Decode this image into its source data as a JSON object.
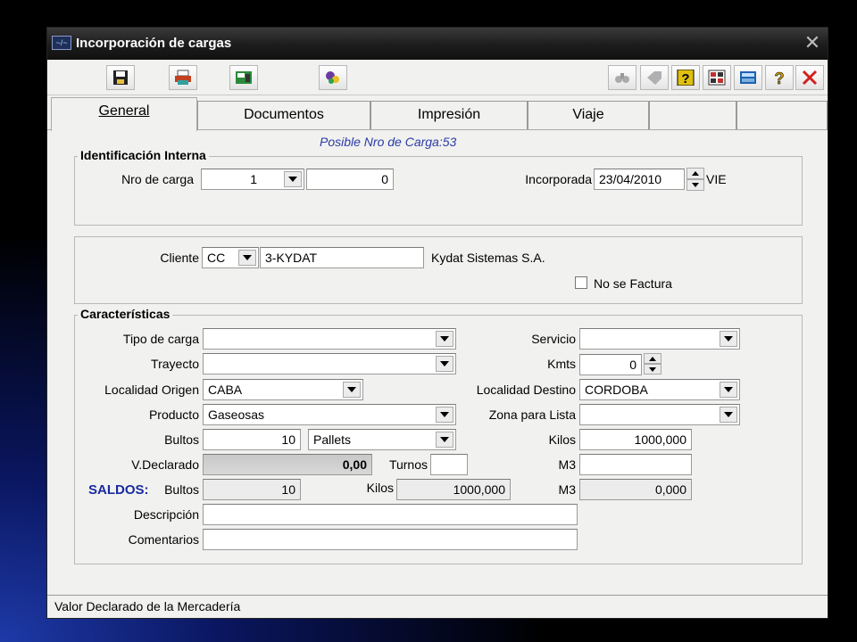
{
  "window": {
    "title": "Incorporación de cargas",
    "app_icon_glyph": "~/~"
  },
  "toolbar": {
    "left_icons": [
      "save-icon",
      "print-icon",
      "card-icon",
      "tools-icon"
    ],
    "right_icons": [
      "binoculars-icon",
      "tag-icon",
      "help-box-icon",
      "grid-icon",
      "calculator-icon",
      "question-icon",
      "close-x-icon"
    ]
  },
  "tabs": [
    {
      "label": "General",
      "active": true
    },
    {
      "label": "Documentos",
      "active": false
    },
    {
      "label": "Impresión",
      "active": false
    },
    {
      "label": "Viaje",
      "active": false
    },
    {
      "label": "",
      "active": false
    },
    {
      "label": "",
      "active": false
    }
  ],
  "possible_number": "Posible Nro de Carga:53",
  "identificacion": {
    "title": "Identificación Interna",
    "nro_label": "Nro de carga",
    "nro_value": "1",
    "nro_value2": "0",
    "incorporada_label": "Incorporada",
    "incorporada_value": "23/04/2010",
    "day": "VIE"
  },
  "cliente": {
    "label": "Cliente",
    "type": "CC",
    "code": "3-KYDAT",
    "name": "Kydat Sistemas S.A.",
    "no_factura_label": "No se Factura",
    "no_factura_checked": false
  },
  "caracteristicas": {
    "title": "Características",
    "tipo_carga_label": "Tipo de carga",
    "tipo_carga_value": "",
    "trayecto_label": "Trayecto",
    "trayecto_value": "",
    "loc_origen_label": "Localidad Origen",
    "loc_origen_value": "CABA",
    "producto_label": "Producto",
    "producto_value": "Gaseosas",
    "bultos_label": "Bultos",
    "bultos_value": "10",
    "bultos_unit": "Pallets",
    "vdeclarado_label": "V.Declarado",
    "vdeclarado_value": "0,00",
    "turnos_label": "Turnos",
    "turnos_value": "",
    "servicio_label": "Servicio",
    "servicio_value": "",
    "kmts_label": "Kmts",
    "kmts_value": "0",
    "loc_destino_label": "Localidad Destino",
    "loc_destino_value": "CORDOBA",
    "zona_label": "Zona para Lista",
    "zona_value": "",
    "kilos_label": "Kilos",
    "kilos_value": "1000,000",
    "m3_label": "M3",
    "m3_value": ""
  },
  "saldos": {
    "title": "SALDOS:",
    "title_color": "#1a2aa0",
    "bultos_label": "Bultos",
    "bultos_value": "10",
    "kilos_label": "Kilos",
    "kilos_value": "1000,000",
    "m3_label": "M3",
    "m3_value": "0,000"
  },
  "descripcion_label": "Descripción",
  "descripcion_value": "",
  "comentarios_label": "Comentarios",
  "comentarios_value": "",
  "status": "Valor Declarado de la Mercadería"
}
